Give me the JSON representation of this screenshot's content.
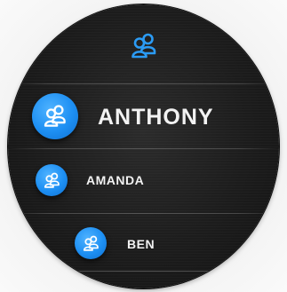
{
  "header": {
    "icon": "contacts-group-icon",
    "accent_color": "#2b9bf4"
  },
  "contacts": [
    {
      "name": "ANTHONY",
      "icon": "contact-avatar-icon"
    },
    {
      "name": "AMANDA",
      "icon": "contact-avatar-icon"
    },
    {
      "name": "BEN",
      "icon": "contact-avatar-icon"
    }
  ],
  "colors": {
    "avatar_blue": "#1d8ff3",
    "screen_background": "#1c1c1c",
    "text": "#f2f2f2"
  }
}
